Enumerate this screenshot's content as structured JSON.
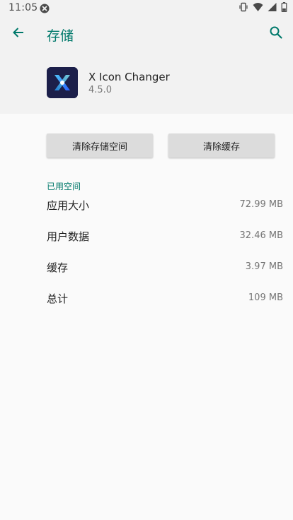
{
  "status_bar": {
    "time": "11:05",
    "notification_icon": "close-circle-icon",
    "right_icons": [
      "vibrate-icon",
      "wifi-icon",
      "signal-icon",
      "battery-icon"
    ]
  },
  "header": {
    "title": "存储",
    "back_icon": "arrow-back-icon",
    "search_icon": "search-icon"
  },
  "app": {
    "name": "X Icon Changer",
    "version": "4.5.0"
  },
  "actions": {
    "clear_storage": "清除存储空间",
    "clear_cache": "清除缓存"
  },
  "usage": {
    "section_title": "已用空间",
    "rows": [
      {
        "label": "应用大小",
        "value": "72.99 MB"
      },
      {
        "label": "用户数据",
        "value": "32.46 MB"
      },
      {
        "label": "缓存",
        "value": "3.97 MB"
      },
      {
        "label": "总计",
        "value": "109 MB"
      }
    ]
  },
  "colors": {
    "accent": "#00796b",
    "header_bg": "#f2f2f2",
    "page_bg": "#fafafa",
    "button_bg": "#dcdcdc"
  }
}
